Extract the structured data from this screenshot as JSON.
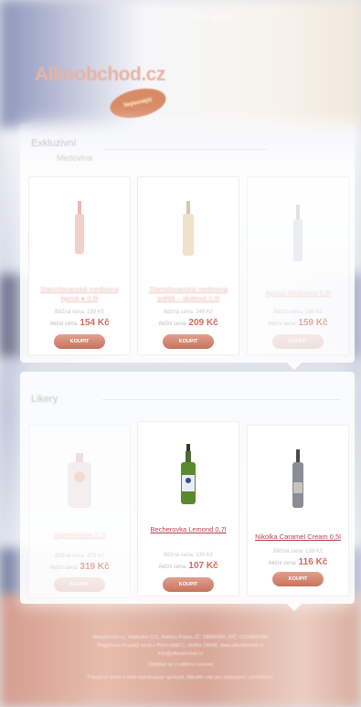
{
  "header": {
    "top_text": "Akční nabídky",
    "logo_text": "Alkoobchod.cz",
    "logo_badge": "Nejlevnější"
  },
  "section1": {
    "title": "Exkluzivní",
    "subtitle": "Medovina",
    "products": [
      {
        "name": "Staroslovanská medovina lipová ● 0,5l",
        "regular": "Běžná cena: 189 Kč",
        "sale_label": "Akční cena:",
        "sale_price": "154 Kč",
        "button": "KOUPIT"
      },
      {
        "name": "Staroslovanská medovina světlá – akátová 0,5l",
        "regular": "Běžná cena: 249 Kč",
        "sale_label": "Akční cena:",
        "sale_price": "209 Kč",
        "button": "KOUPIT"
      },
      {
        "name": "Apicus Medovina 0,5l",
        "regular": "Běžná cena: 189 Kč",
        "sale_label": "Akční cena:",
        "sale_price": "159 Kč",
        "button": "KOUPIT"
      }
    ]
  },
  "section2": {
    "title": "Likery",
    "products": [
      {
        "name": "Jägermeister 0,7l",
        "regular": "Běžná cena: 379 Kč",
        "sale_label": "Akční cena:",
        "sale_price": "319 Kč",
        "button": "KOUPIT"
      },
      {
        "name": "Becherovka Lemond 0,7l",
        "regular": "Běžná cena: 130 Kč",
        "sale_label": "Akční cena:",
        "sale_price": "107 Kč",
        "button": "KOUPIT"
      },
      {
        "name": "Nikolka Caramel Cream 0,5l",
        "regular": "Běžná cena: 139 Kč",
        "sale_label": "Akční cena:",
        "sale_price": "116 Kč",
        "button": "KOUPIT"
      }
    ]
  },
  "footer": {
    "line1": "Alkoobchod.cz, Nádražní 212, Nebory Praha, IČ: 28890394, DIČ: CZ28890394",
    "line2": "Registrace Krajský soud v Plzni oddíl C, vložka 24548, www.alkoobchod.cz",
    "line3": "info@alkoobchod.cz",
    "line4": "Odhlásit se z odběru novinek",
    "line5": "Pokud se tento e-mail nezobrazuje správně, klikněte zde pro zobrazení v prohlížeči."
  }
}
